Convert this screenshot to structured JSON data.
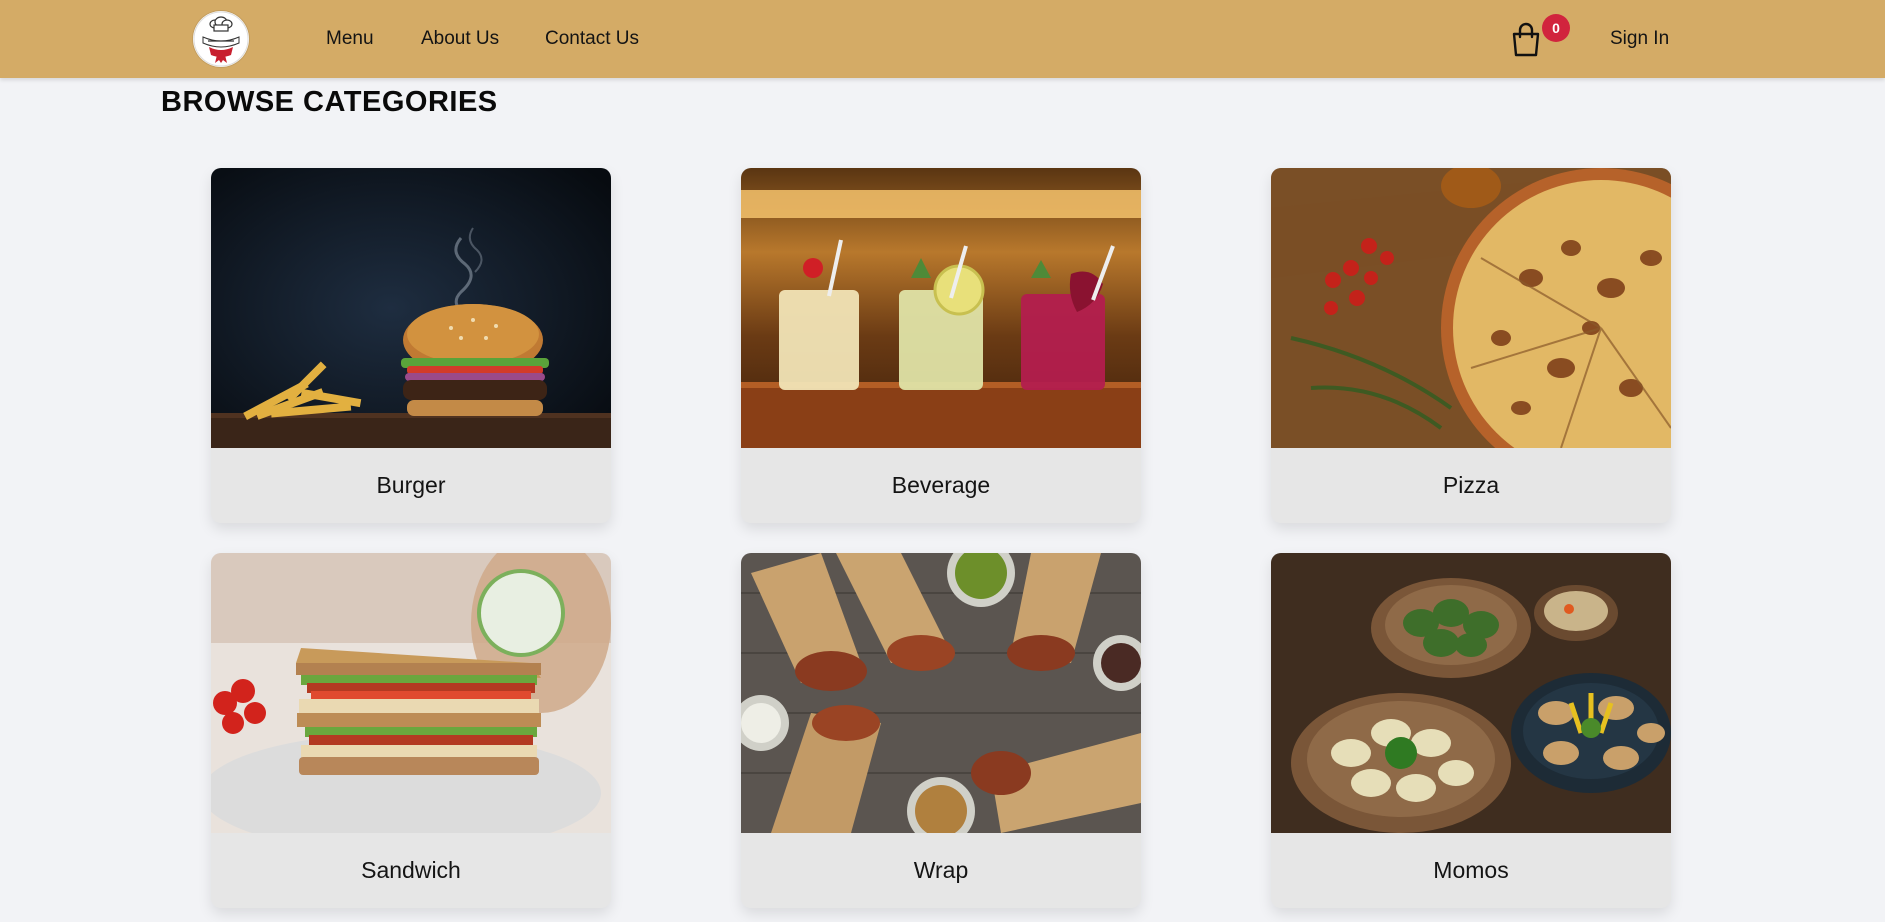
{
  "nav": {
    "links": [
      "Menu",
      "About Us",
      "Contact Us"
    ],
    "cart_count": "0",
    "signin_label": "Sign In"
  },
  "page": {
    "title": "BROWSE CATEGORIES"
  },
  "categories": [
    {
      "name": "Burger"
    },
    {
      "name": "Beverage"
    },
    {
      "name": "Pizza"
    },
    {
      "name": "Sandwich"
    },
    {
      "name": "Wrap"
    },
    {
      "name": "Momos"
    }
  ],
  "colors": {
    "navbar": "#d4ab66",
    "badge": "#d1243d",
    "page_background": "#f2f3f6",
    "card_label_background": "#e6e6e6"
  }
}
